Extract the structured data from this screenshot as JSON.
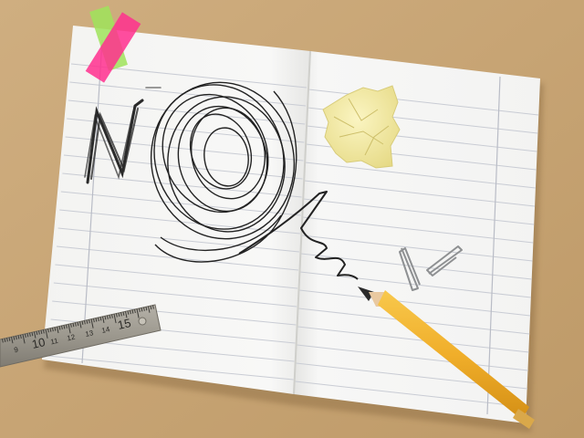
{
  "scene": {
    "handwritten_word": "NO",
    "ruler": {
      "tick_labels": [
        "9",
        "10",
        "11",
        "12",
        "13",
        "14",
        "15"
      ]
    }
  },
  "colors": {
    "desk": "#c9a87a",
    "paper": "#f5f5f4",
    "rule_line": "#c9ccd4",
    "margin_line": "#b9bcc6",
    "graphite": "#2a2a2a",
    "sticky_note": "#f6eea8",
    "tape_green": "#9fe35a",
    "tape_pink": "#ff2f8e",
    "pencil_body": "#f2b231",
    "ruler_metal": "#9a968c",
    "paper_clip": "#8e9092"
  },
  "icons": [
    "notebook",
    "crumpled-sticky-note",
    "pencil",
    "metal-ruler",
    "paper-clip",
    "washi-tape",
    "scribble"
  ]
}
